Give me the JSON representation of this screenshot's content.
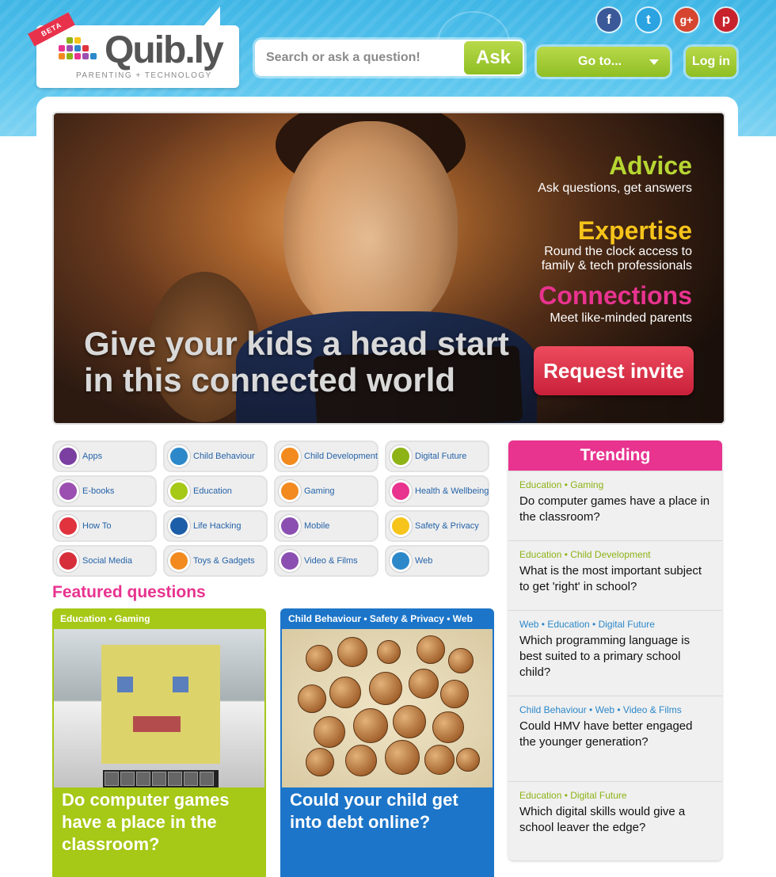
{
  "brand": {
    "name": "Quib.ly",
    "tagline": "PARENTING + TECHNOLOGY",
    "badge": "BETA"
  },
  "social": [
    {
      "name": "facebook-icon",
      "glyph": "f"
    },
    {
      "name": "twitter-icon",
      "glyph": "t"
    },
    {
      "name": "google-plus-icon",
      "glyph": "g+"
    },
    {
      "name": "pinterest-icon",
      "glyph": "p"
    }
  ],
  "search": {
    "placeholder": "Search or ask a question!",
    "button": "Ask"
  },
  "nav": {
    "goto_label": "Go to...",
    "login_label": "Log in"
  },
  "hero": {
    "headline": "Give your kids a head start in this connected world",
    "features": [
      {
        "title": "Advice",
        "subtitle": "Ask questions, get answers",
        "color": "#b7d632"
      },
      {
        "title": "Expertise",
        "subtitle": "Round the clock access to family & tech professionals",
        "color": "#f6c41a"
      },
      {
        "title": "Connections",
        "subtitle": "Meet like-minded parents",
        "color": "#e8338f"
      }
    ],
    "cta": "Request invite"
  },
  "categories": [
    {
      "label": "Apps",
      "icon": "apps-icon",
      "color": "#7a3fa0"
    },
    {
      "label": "Child Behaviour",
      "icon": "child-behaviour-icon",
      "color": "#2c88c9"
    },
    {
      "label": "Child Development",
      "icon": "child-development-icon",
      "color": "#f28a1f"
    },
    {
      "label": "Digital Future",
      "icon": "digital-future-icon",
      "color": "#8db317"
    },
    {
      "label": "E-books",
      "icon": "ebooks-icon",
      "color": "#9b4fb0"
    },
    {
      "label": "Education",
      "icon": "education-icon",
      "color": "#a6c816"
    },
    {
      "label": "Gaming",
      "icon": "gaming-icon",
      "color": "#f28a1f"
    },
    {
      "label": "Health & Wellbeing",
      "icon": "health-icon",
      "color": "#e8338f"
    },
    {
      "label": "How To",
      "icon": "how-to-icon",
      "color": "#e0333e"
    },
    {
      "label": "Life Hacking",
      "icon": "life-hacking-icon",
      "color": "#1c5ea8"
    },
    {
      "label": "Mobile",
      "icon": "mobile-icon",
      "color": "#8a4fb0"
    },
    {
      "label": "Safety & Privacy",
      "icon": "safety-icon",
      "color": "#f6c41a"
    },
    {
      "label": "Social Media",
      "icon": "social-media-icon",
      "color": "#d62f3b"
    },
    {
      "label": "Toys & Gadgets",
      "icon": "toys-icon",
      "color": "#f28a1f"
    },
    {
      "label": "Video & Films",
      "icon": "video-icon",
      "color": "#8a4fb0"
    },
    {
      "label": "Web",
      "icon": "web-icon",
      "color": "#2c88c9"
    }
  ],
  "featured": {
    "heading": "Featured questions",
    "items": [
      {
        "tags": "Education • Gaming",
        "title": "Do computer games have a place in the classroom?",
        "color": "#a6c816"
      },
      {
        "tags": "Child Behaviour • Safety & Privacy • Web",
        "title": "Could your child get into debt online?",
        "color": "#1c75c8"
      }
    ]
  },
  "trending": {
    "heading": "Trending",
    "items": [
      {
        "tags": "Education • Gaming",
        "tag_color": "green",
        "question": "Do computer games have a place in the classroom?"
      },
      {
        "tags": "Education • Child Development",
        "tag_color": "green",
        "question": "What is the most important subject to get 'right' in school?"
      },
      {
        "tags": "Web • Education • Digital Future",
        "tag_color": "blue",
        "question": "Which programming language is best suited to a primary school child?"
      },
      {
        "tags": "Child Behaviour • Web • Video & Films",
        "tag_color": "blue",
        "question": "Could HMV have better engaged the younger generation?"
      },
      {
        "tags": "Education • Digital Future",
        "tag_color": "green",
        "question": "Which digital skills would give a school leaver the edge?"
      }
    ]
  }
}
